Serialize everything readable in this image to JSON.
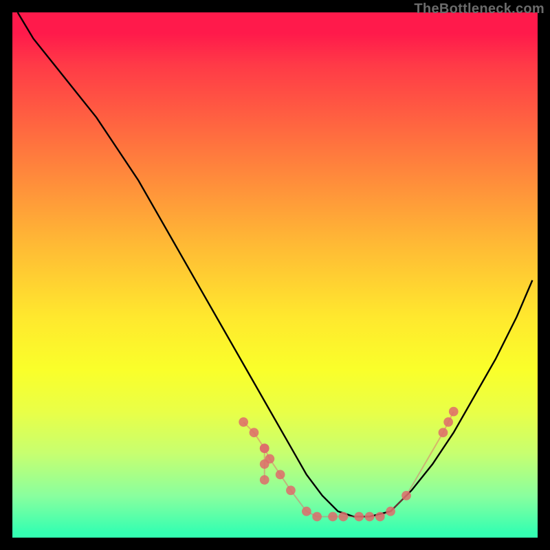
{
  "watermark": "TheBottleneck.com",
  "chart_data": {
    "type": "line",
    "title": "",
    "xlabel": "",
    "ylabel": "",
    "xlim": [
      0,
      100
    ],
    "ylim": [
      0,
      100
    ],
    "background": "vertical-gradient red→yellow→green",
    "series": [
      {
        "name": "bottleneck-curve",
        "color": "#000000",
        "x": [
          1,
          4,
          8,
          12,
          16,
          20,
          24,
          28,
          32,
          36,
          40,
          44,
          48,
          52,
          56,
          59,
          62,
          65,
          68,
          72,
          76,
          80,
          84,
          88,
          92,
          96,
          99
        ],
        "y": [
          100,
          95,
          90,
          85,
          80,
          74,
          68,
          61,
          54,
          47,
          40,
          33,
          26,
          19,
          12,
          8,
          5,
          4,
          4,
          5,
          9,
          14,
          20,
          27,
          34,
          42,
          49
        ]
      },
      {
        "name": "scatter-markers",
        "type": "scatter",
        "color": "#de6b6b",
        "points": [
          {
            "x": 44,
            "y": 22
          },
          {
            "x": 46,
            "y": 20
          },
          {
            "x": 48,
            "y": 17
          },
          {
            "x": 49,
            "y": 15
          },
          {
            "x": 51,
            "y": 12
          },
          {
            "x": 53,
            "y": 9
          },
          {
            "x": 56,
            "y": 5
          },
          {
            "x": 58,
            "y": 4
          },
          {
            "x": 61,
            "y": 4
          },
          {
            "x": 63,
            "y": 4
          },
          {
            "x": 66,
            "y": 4
          },
          {
            "x": 68,
            "y": 4
          },
          {
            "x": 70,
            "y": 4
          },
          {
            "x": 72,
            "y": 5
          },
          {
            "x": 75,
            "y": 8
          },
          {
            "x": 82,
            "y": 20
          },
          {
            "x": 83,
            "y": 22
          },
          {
            "x": 84,
            "y": 24
          }
        ]
      },
      {
        "name": "scatter-vertical-bridge",
        "type": "scatter",
        "color": "#de6b6b",
        "points": [
          {
            "x": 48,
            "y": 17
          },
          {
            "x": 48,
            "y": 14
          },
          {
            "x": 48,
            "y": 11
          }
        ]
      }
    ]
  }
}
